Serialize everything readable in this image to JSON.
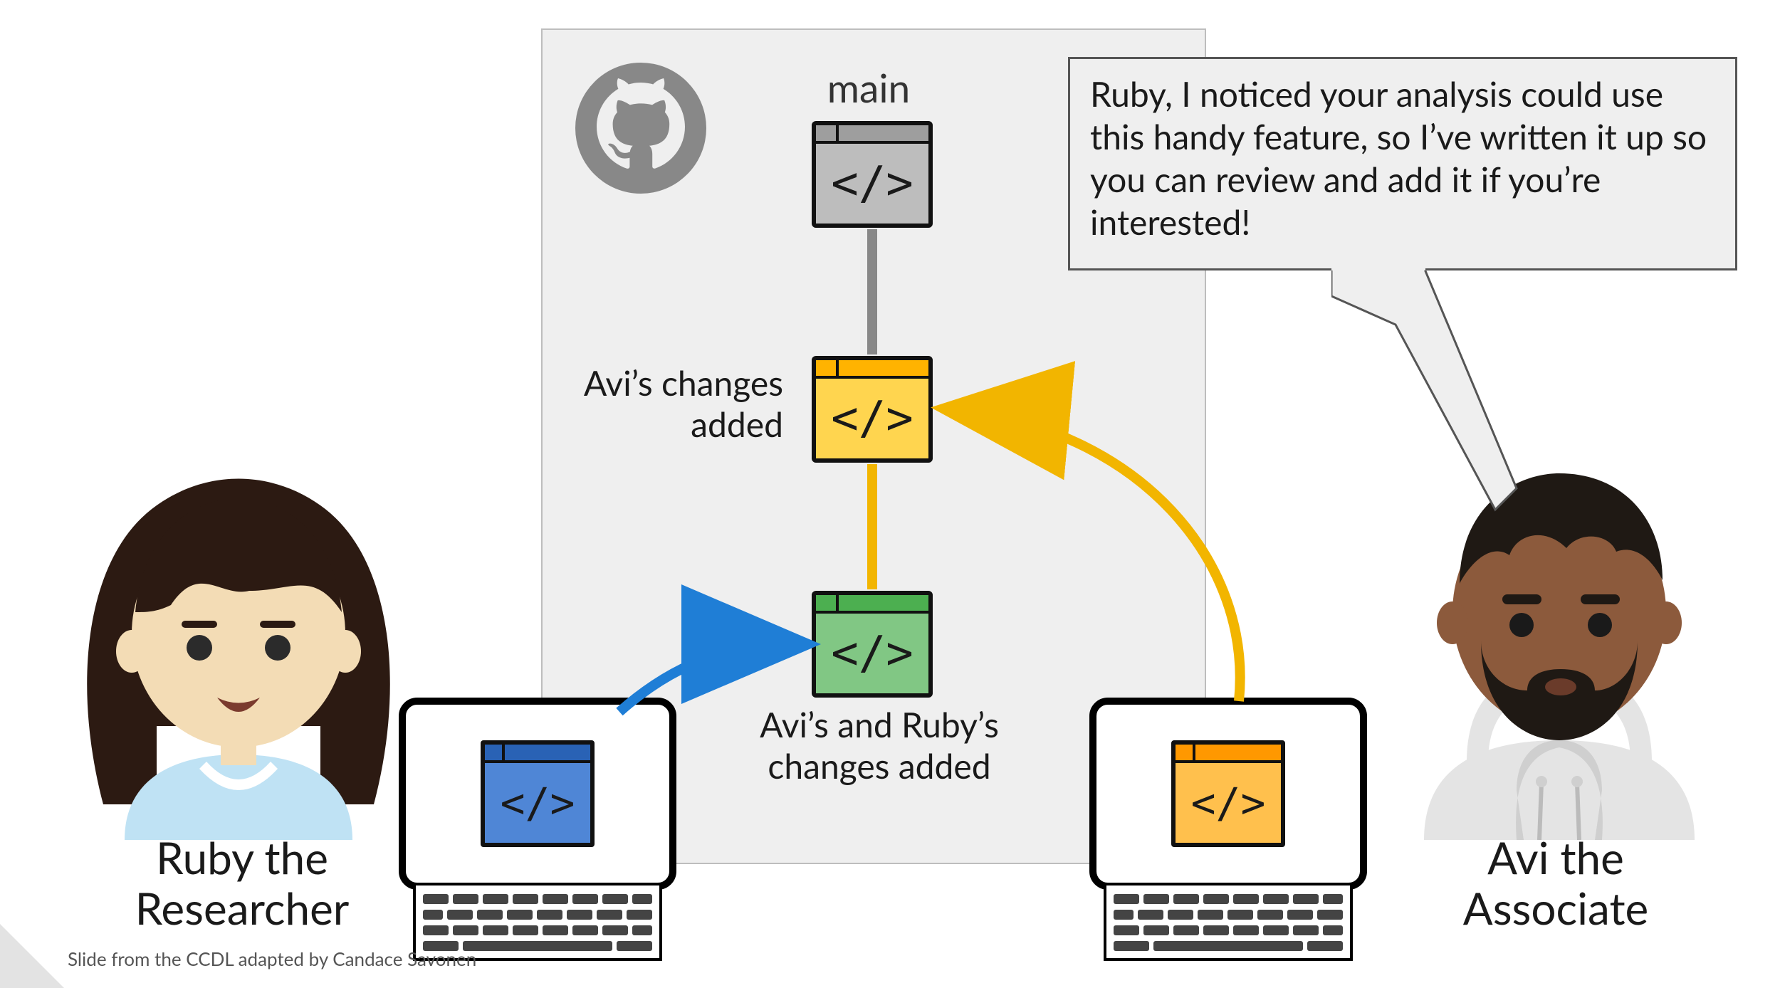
{
  "repo": {
    "main_label": "main",
    "avi_commit_label": "Avi’s changes added",
    "both_commit_label": "Avi’s and Ruby’s changes added"
  },
  "people": {
    "ruby": {
      "caption": "Ruby the Researcher"
    },
    "avi": {
      "caption": "Avi the Associate"
    }
  },
  "speech_bubble": "Ruby, I noticed your analysis could use this handy feature, so I’ve written it up so you can review and add it if you’re interested!",
  "attribution": "Slide from the CCDL adapted by Candace Savonen",
  "code_glyph": "</>",
  "colors": {
    "panel_bg": "#efefef",
    "arrow_blue": "#1f7ed6",
    "arrow_yellow": "#f2b500",
    "connector_gray": "#888888"
  }
}
